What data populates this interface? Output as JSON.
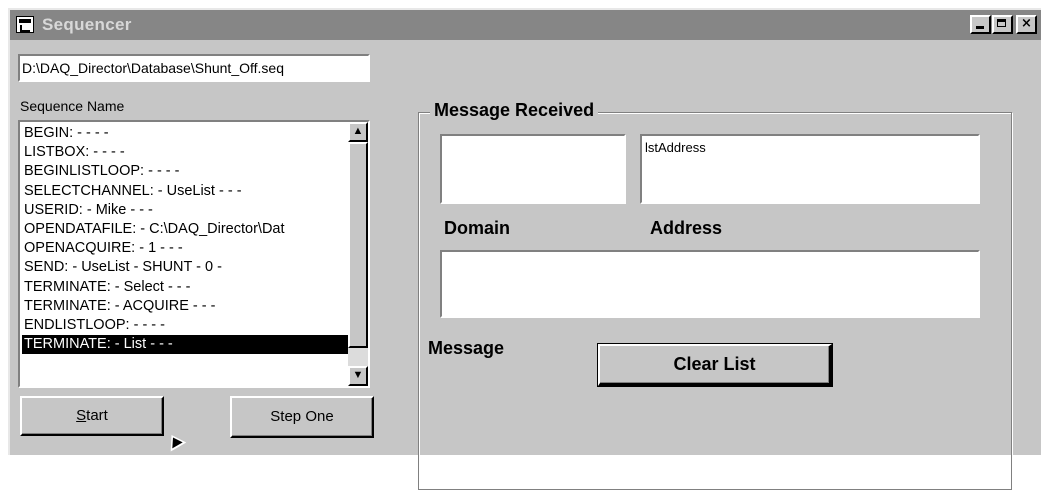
{
  "window": {
    "title": "Sequencer",
    "icon": "app-window-icon",
    "controls": {
      "minimize": "minimize-icon",
      "maximize": "maximize-icon",
      "close": "×"
    }
  },
  "file_path": "D:\\DAQ_Director\\Database\\Shunt_Off.seq",
  "sequence": {
    "label": "Sequence Name",
    "items": [
      "BEGIN: - - - -",
      "LISTBOX: - - - -",
      "BEGINLISTLOOP: - - - -",
      "SELECTCHANNEL: - UseList - - -",
      "USERID: - Mike - - -",
      "OPENDATAFILE: - C:\\DAQ_Director\\Dat",
      "OPENACQUIRE: - 1 - - -",
      "SEND: - UseList - SHUNT - 0 -",
      "TERMINATE: - Select - - -",
      "TERMINATE: - ACQUIRE - - -",
      "ENDLISTLOOP: - - - -",
      "TERMINATE: - List - - -"
    ],
    "selected_index": 11,
    "scroll_up": "▲",
    "scroll_down": "▼"
  },
  "buttons": {
    "start_underlined": "S",
    "start_rest": "tart",
    "step_one": "Step One",
    "clear_list": "Clear List"
  },
  "message_group": {
    "title": "Message Received",
    "domain_label": "Domain",
    "domain_value": "",
    "address_label": "Address",
    "address_value": "lstAddress",
    "message_label": "Message",
    "message_value": ""
  },
  "colors": {
    "titlebar": "#868686",
    "face": "#c6c6c6",
    "selection": "#000000"
  }
}
